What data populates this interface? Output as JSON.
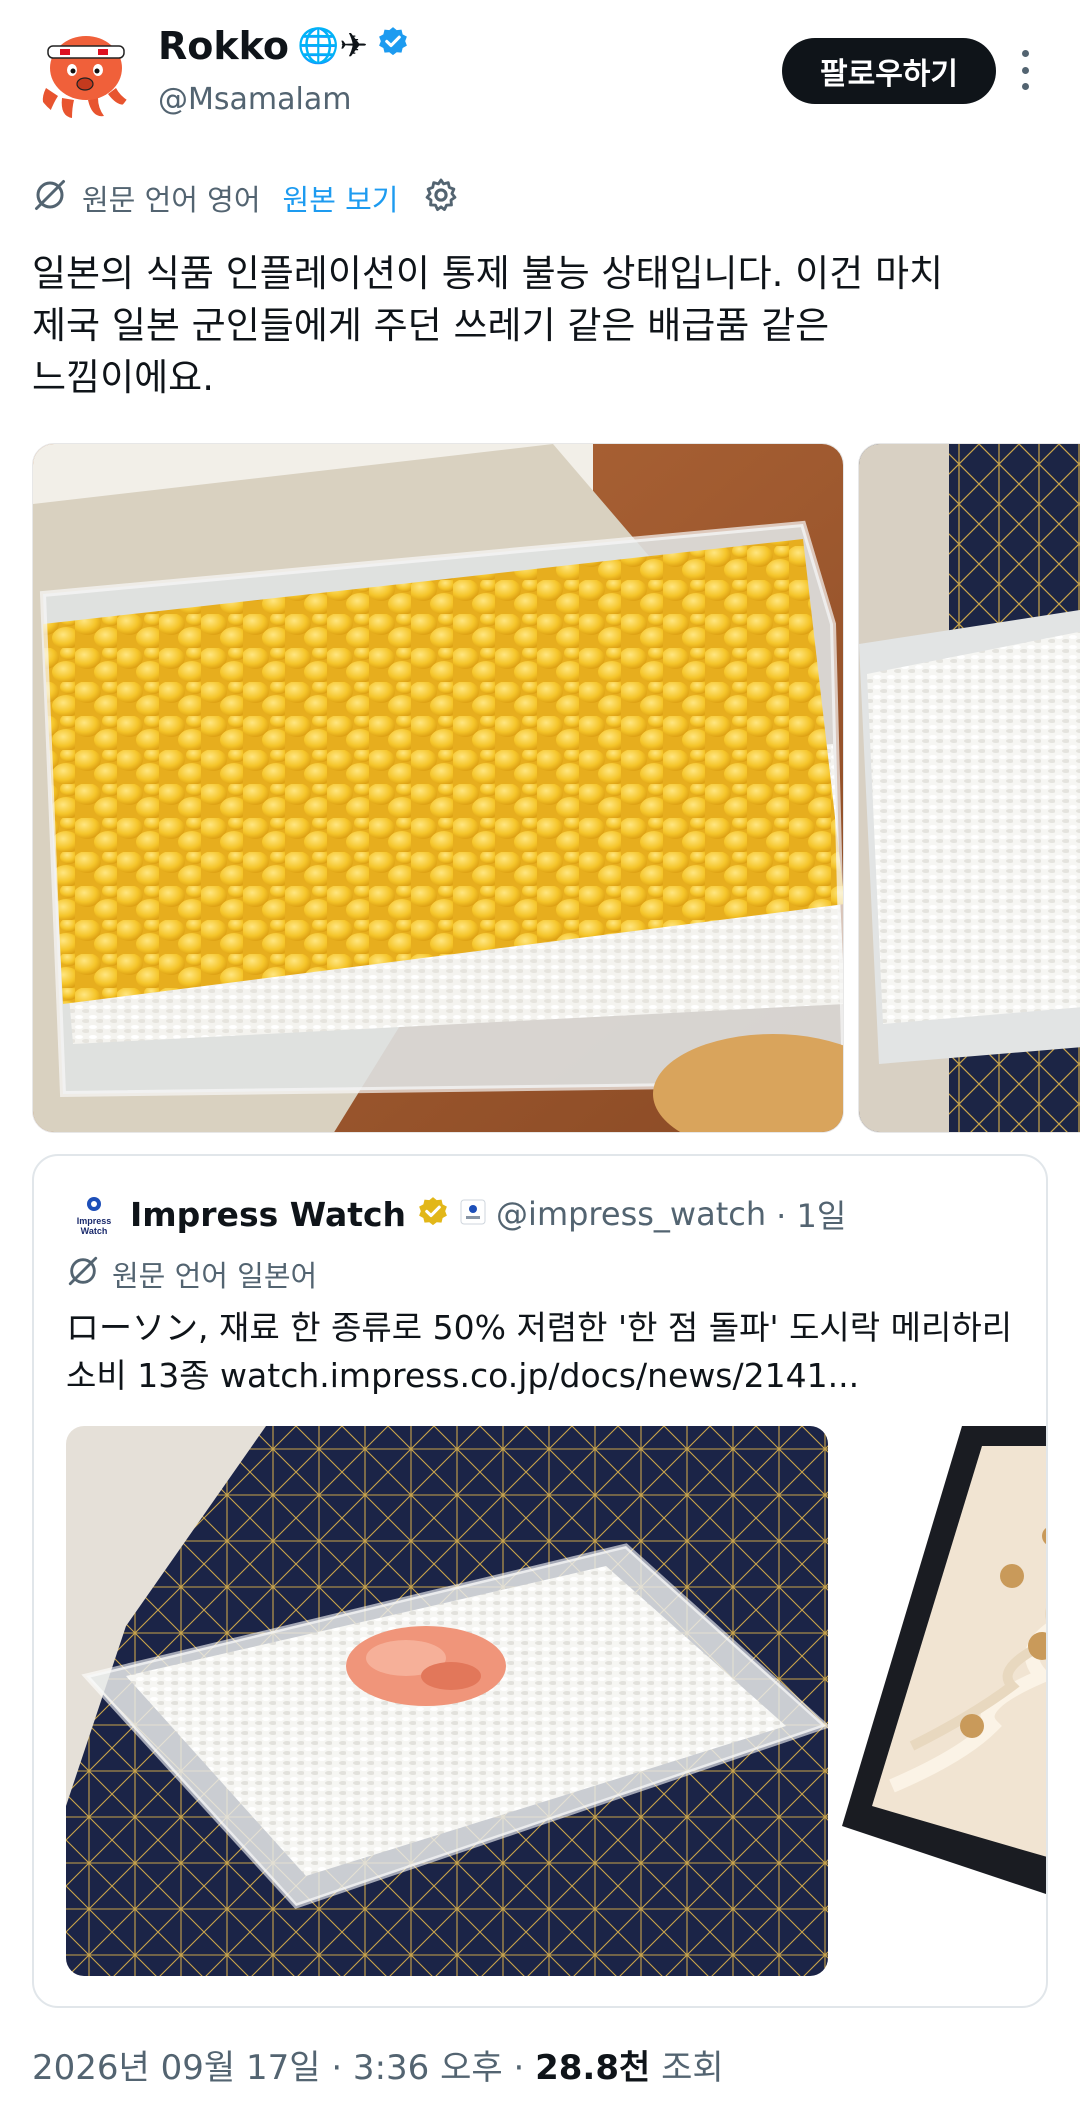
{
  "author": {
    "display_name": "Rokko",
    "name_emojis": "🌐✈",
    "handle": "@Msamalam",
    "verified": true
  },
  "follow_button": {
    "label": "팔로우하기"
  },
  "translate": {
    "label": "원문 언어 영어",
    "view_original": "원본 보기"
  },
  "tweet": {
    "lines": [
      "일본의 식품 인플레이션이 통제 불능 상태입니다. 이건 마치",
      "제국 일본 군인들에게 주던 쓰레기 같은 배급품 같은",
      "느낌이에요."
    ]
  },
  "quote": {
    "name": "Impress Watch",
    "handle": "@impress_watch",
    "time": "· 1일",
    "translate_label": "원문 언어 일본어",
    "lines": [
      "ローソン, 재료 한 종류로 50% 저렴한 '한 점 돌파' 도시락 메리하리",
      "소비 13종 watch.impress.co.jp/docs/news/2141..."
    ],
    "logo_text_top": "Impress",
    "logo_text_bottom": "Watch"
  },
  "meta": {
    "date": "2026년 09월 17일 · 3:36 오후 ·",
    "views": "28.8천",
    "views_label": "조회"
  },
  "colors": {
    "accent": "#1d9bf0",
    "verified_gold": "#e2b719",
    "secondary_text": "#536471"
  }
}
